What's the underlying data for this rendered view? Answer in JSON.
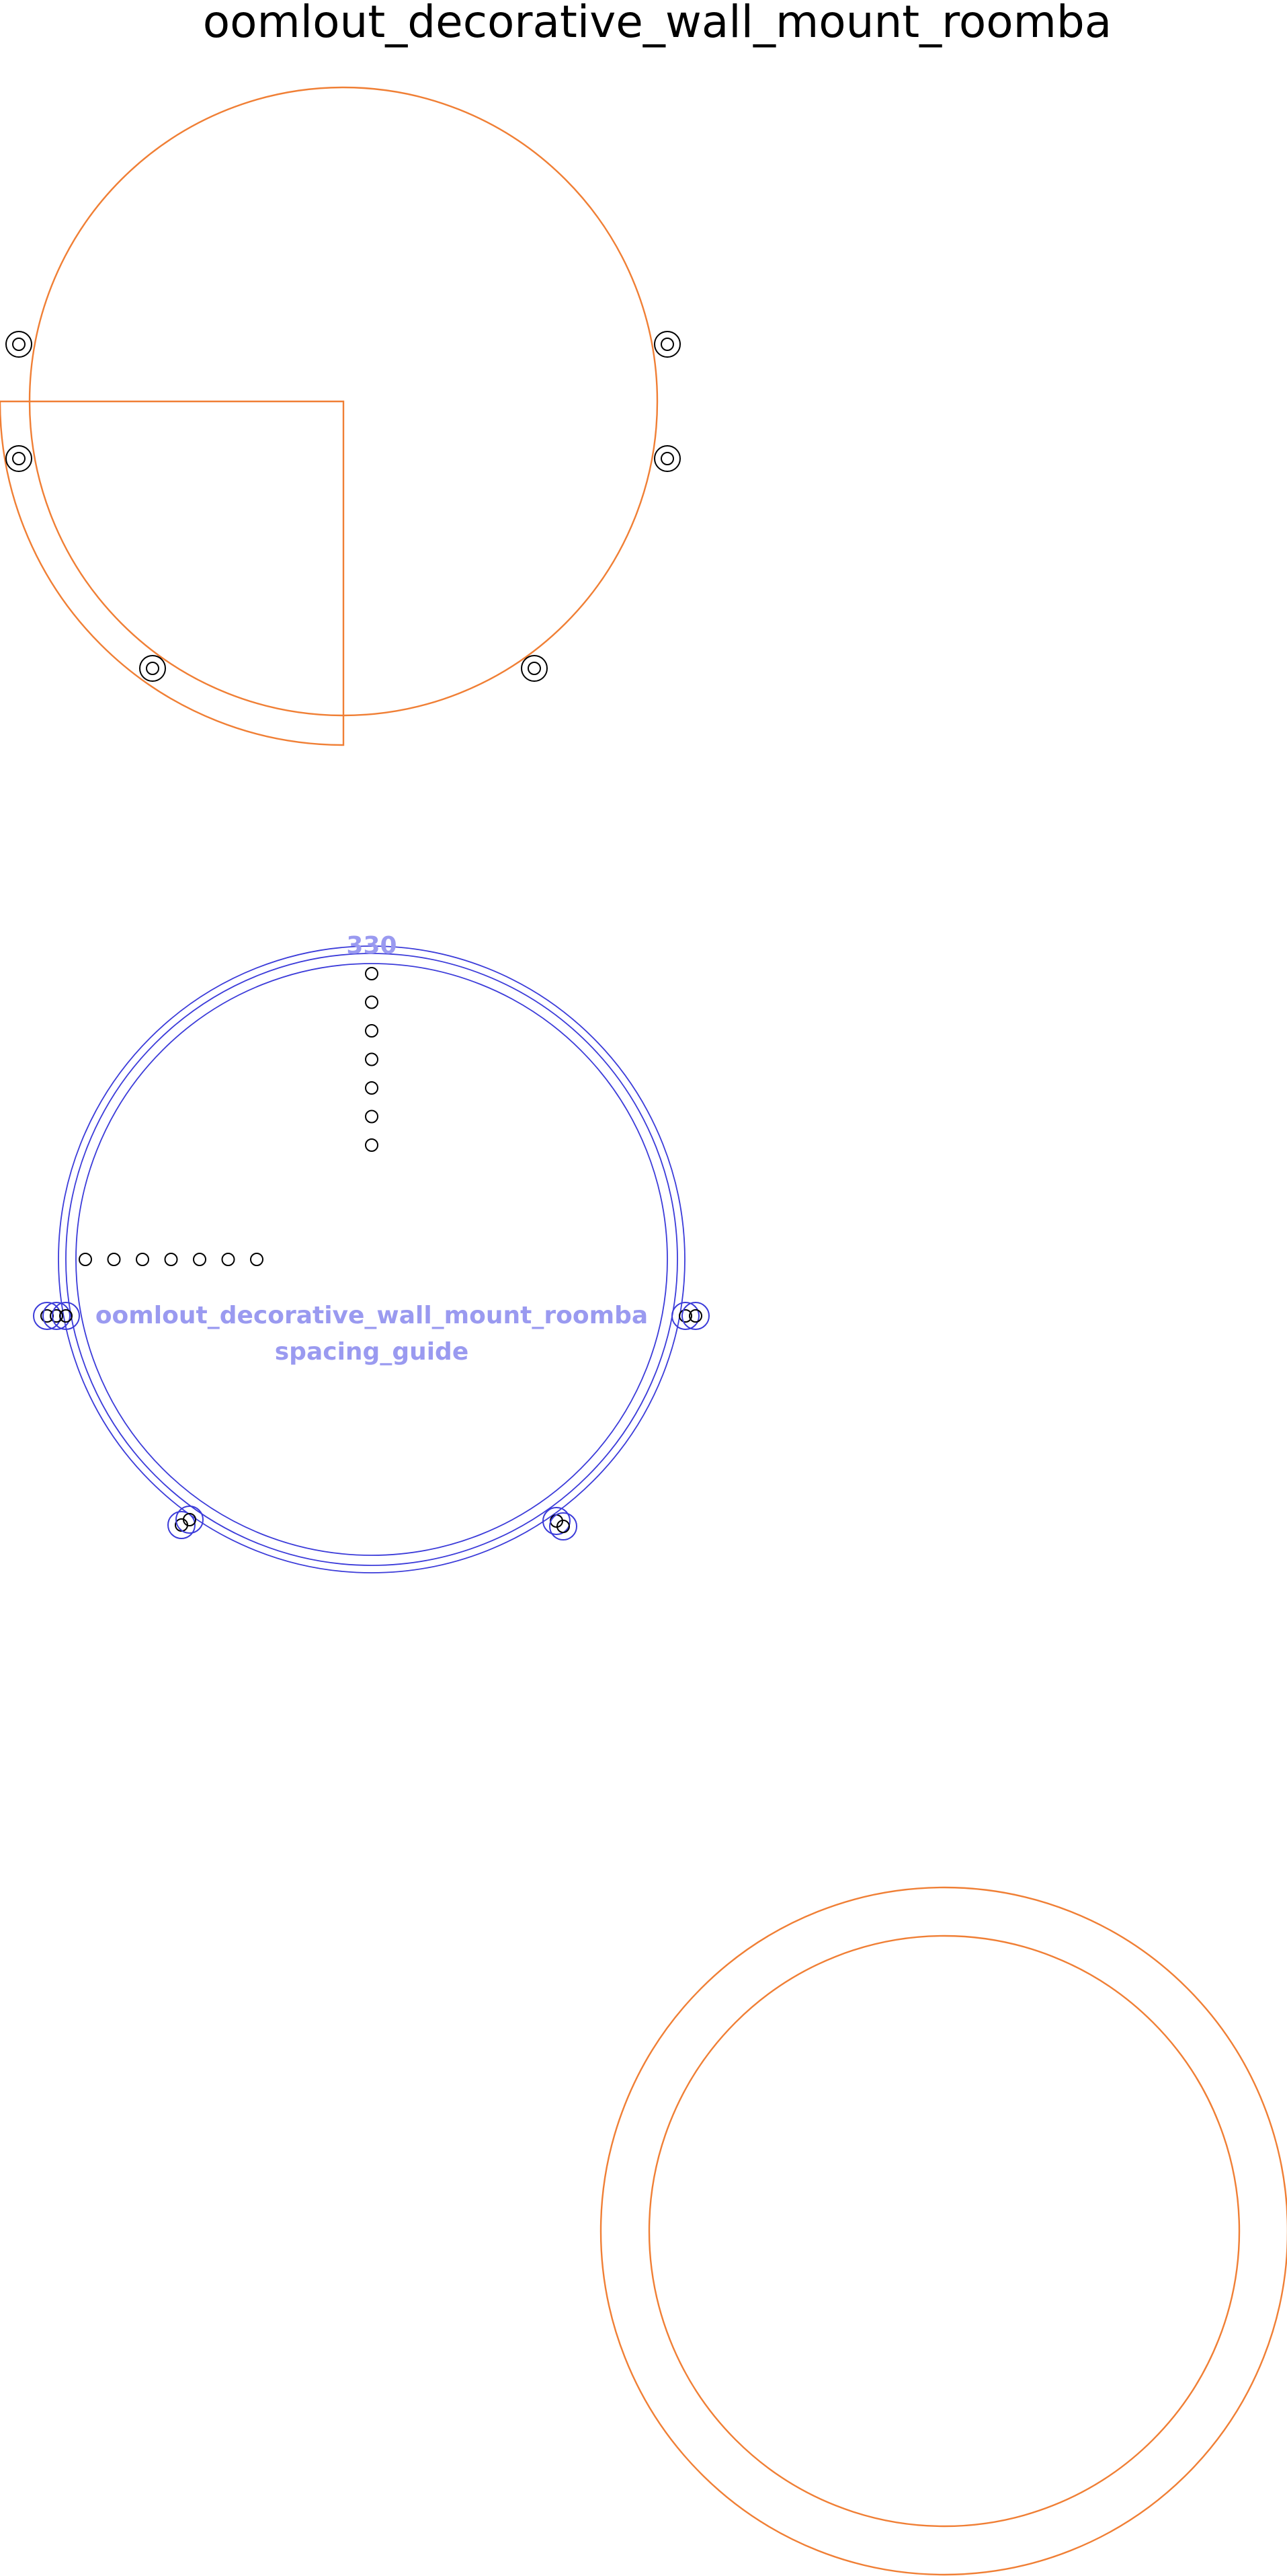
{
  "title": "oomlout_decorative_wall_mount_roomba",
  "spacing_guide": {
    "number_label": "330",
    "name_label": "oomlout_decorative_wall_mount_roomba",
    "sub_label": "spacing_guide"
  },
  "colors": {
    "cut_line": "#f07f35",
    "guide_line": "#3b3bd9",
    "guide_text": "#9a9af0",
    "hole": "#000000"
  }
}
